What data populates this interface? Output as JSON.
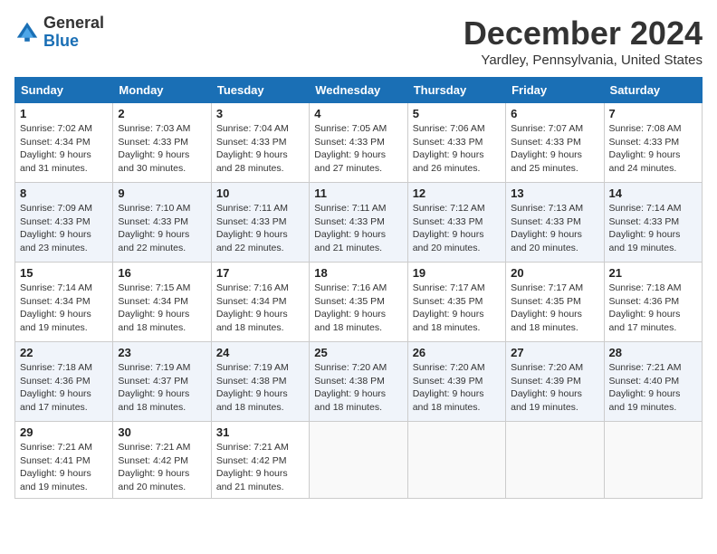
{
  "header": {
    "logo_general": "General",
    "logo_blue": "Blue",
    "month_title": "December 2024",
    "location": "Yardley, Pennsylvania, United States"
  },
  "days_of_week": [
    "Sunday",
    "Monday",
    "Tuesday",
    "Wednesday",
    "Thursday",
    "Friday",
    "Saturday"
  ],
  "weeks": [
    [
      {
        "day": "1",
        "sunrise": "7:02 AM",
        "sunset": "4:34 PM",
        "daylight": "9 hours and 31 minutes."
      },
      {
        "day": "2",
        "sunrise": "7:03 AM",
        "sunset": "4:33 PM",
        "daylight": "9 hours and 30 minutes."
      },
      {
        "day": "3",
        "sunrise": "7:04 AM",
        "sunset": "4:33 PM",
        "daylight": "9 hours and 28 minutes."
      },
      {
        "day": "4",
        "sunrise": "7:05 AM",
        "sunset": "4:33 PM",
        "daylight": "9 hours and 27 minutes."
      },
      {
        "day": "5",
        "sunrise": "7:06 AM",
        "sunset": "4:33 PM",
        "daylight": "9 hours and 26 minutes."
      },
      {
        "day": "6",
        "sunrise": "7:07 AM",
        "sunset": "4:33 PM",
        "daylight": "9 hours and 25 minutes."
      },
      {
        "day": "7",
        "sunrise": "7:08 AM",
        "sunset": "4:33 PM",
        "daylight": "9 hours and 24 minutes."
      }
    ],
    [
      {
        "day": "8",
        "sunrise": "7:09 AM",
        "sunset": "4:33 PM",
        "daylight": "9 hours and 23 minutes."
      },
      {
        "day": "9",
        "sunrise": "7:10 AM",
        "sunset": "4:33 PM",
        "daylight": "9 hours and 22 minutes."
      },
      {
        "day": "10",
        "sunrise": "7:11 AM",
        "sunset": "4:33 PM",
        "daylight": "9 hours and 22 minutes."
      },
      {
        "day": "11",
        "sunrise": "7:11 AM",
        "sunset": "4:33 PM",
        "daylight": "9 hours and 21 minutes."
      },
      {
        "day": "12",
        "sunrise": "7:12 AM",
        "sunset": "4:33 PM",
        "daylight": "9 hours and 20 minutes."
      },
      {
        "day": "13",
        "sunrise": "7:13 AM",
        "sunset": "4:33 PM",
        "daylight": "9 hours and 20 minutes."
      },
      {
        "day": "14",
        "sunrise": "7:14 AM",
        "sunset": "4:33 PM",
        "daylight": "9 hours and 19 minutes."
      }
    ],
    [
      {
        "day": "15",
        "sunrise": "7:14 AM",
        "sunset": "4:34 PM",
        "daylight": "9 hours and 19 minutes."
      },
      {
        "day": "16",
        "sunrise": "7:15 AM",
        "sunset": "4:34 PM",
        "daylight": "9 hours and 18 minutes."
      },
      {
        "day": "17",
        "sunrise": "7:16 AM",
        "sunset": "4:34 PM",
        "daylight": "9 hours and 18 minutes."
      },
      {
        "day": "18",
        "sunrise": "7:16 AM",
        "sunset": "4:35 PM",
        "daylight": "9 hours and 18 minutes."
      },
      {
        "day": "19",
        "sunrise": "7:17 AM",
        "sunset": "4:35 PM",
        "daylight": "9 hours and 18 minutes."
      },
      {
        "day": "20",
        "sunrise": "7:17 AM",
        "sunset": "4:35 PM",
        "daylight": "9 hours and 18 minutes."
      },
      {
        "day": "21",
        "sunrise": "7:18 AM",
        "sunset": "4:36 PM",
        "daylight": "9 hours and 17 minutes."
      }
    ],
    [
      {
        "day": "22",
        "sunrise": "7:18 AM",
        "sunset": "4:36 PM",
        "daylight": "9 hours and 17 minutes."
      },
      {
        "day": "23",
        "sunrise": "7:19 AM",
        "sunset": "4:37 PM",
        "daylight": "9 hours and 18 minutes."
      },
      {
        "day": "24",
        "sunrise": "7:19 AM",
        "sunset": "4:38 PM",
        "daylight": "9 hours and 18 minutes."
      },
      {
        "day": "25",
        "sunrise": "7:20 AM",
        "sunset": "4:38 PM",
        "daylight": "9 hours and 18 minutes."
      },
      {
        "day": "26",
        "sunrise": "7:20 AM",
        "sunset": "4:39 PM",
        "daylight": "9 hours and 18 minutes."
      },
      {
        "day": "27",
        "sunrise": "7:20 AM",
        "sunset": "4:39 PM",
        "daylight": "9 hours and 19 minutes."
      },
      {
        "day": "28",
        "sunrise": "7:21 AM",
        "sunset": "4:40 PM",
        "daylight": "9 hours and 19 minutes."
      }
    ],
    [
      {
        "day": "29",
        "sunrise": "7:21 AM",
        "sunset": "4:41 PM",
        "daylight": "9 hours and 19 minutes."
      },
      {
        "day": "30",
        "sunrise": "7:21 AM",
        "sunset": "4:42 PM",
        "daylight": "9 hours and 20 minutes."
      },
      {
        "day": "31",
        "sunrise": "7:21 AM",
        "sunset": "4:42 PM",
        "daylight": "9 hours and 21 minutes."
      },
      null,
      null,
      null,
      null
    ]
  ],
  "labels": {
    "sunrise": "Sunrise:",
    "sunset": "Sunset:",
    "daylight": "Daylight:"
  }
}
